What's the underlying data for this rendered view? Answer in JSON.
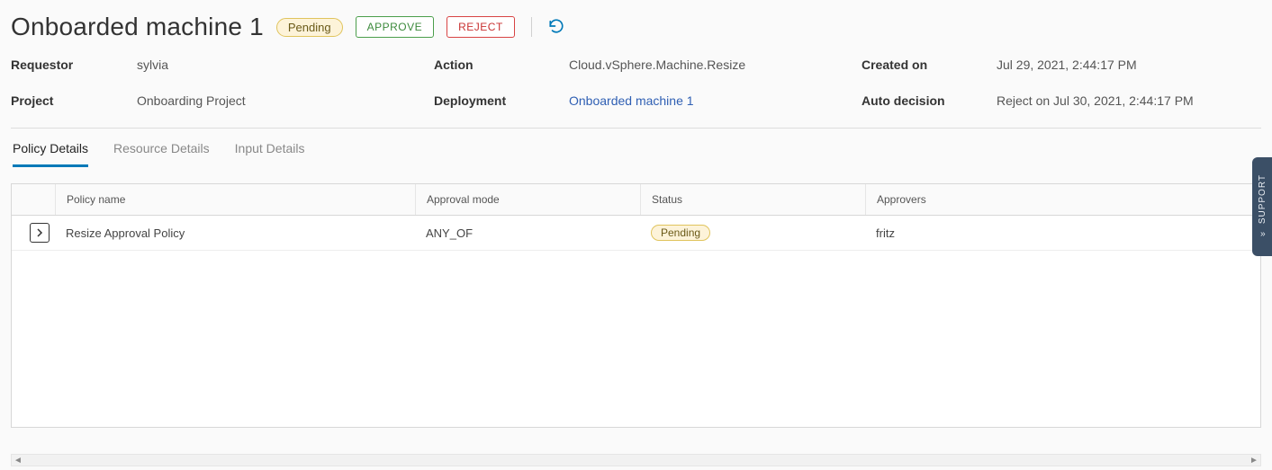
{
  "header": {
    "title": "Onboarded machine 1",
    "status_badge": "Pending",
    "approve_label": "APPROVE",
    "reject_label": "REJECT"
  },
  "meta": {
    "requestor_label": "Requestor",
    "requestor_value": "sylvia",
    "action_label": "Action",
    "action_value": "Cloud.vSphere.Machine.Resize",
    "created_label": "Created on",
    "created_value": "Jul 29, 2021, 2:44:17 PM",
    "project_label": "Project",
    "project_value": "Onboarding Project",
    "deployment_label": "Deployment",
    "deployment_value": "Onboarded machine 1",
    "autodecision_label": "Auto decision",
    "autodecision_value": "Reject on Jul 30, 2021, 2:44:17 PM"
  },
  "tabs": {
    "policy": "Policy Details",
    "resource": "Resource Details",
    "input": "Input Details"
  },
  "table": {
    "headers": {
      "policy_name": "Policy name",
      "approval_mode": "Approval mode",
      "status": "Status",
      "approvers": "Approvers"
    },
    "rows": [
      {
        "policy_name": "Resize Approval Policy",
        "approval_mode": "ANY_OF",
        "status": "Pending",
        "approvers": "fritz"
      }
    ]
  },
  "support": {
    "label": "SUPPORT"
  }
}
